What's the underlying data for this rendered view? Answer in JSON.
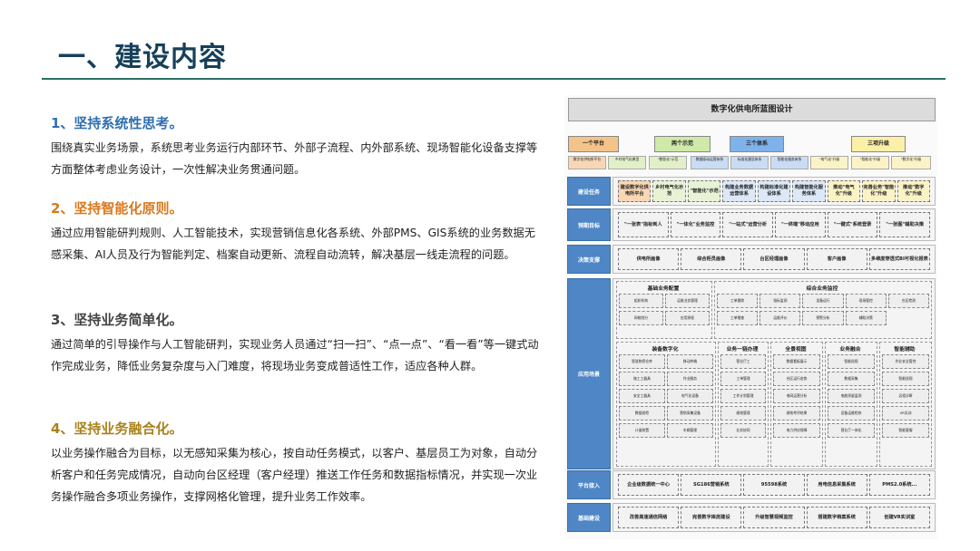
{
  "page": {
    "title": "一、建设内容"
  },
  "sections": [
    {
      "heading": "1、坚持系统性思考。",
      "body": "围绕真实业务场景，系统思考业务运行内部环节、外部子流程、内外部系统、现场智能化设备支撑等方面整体考虑业务设计，一次性解决业务贯通问题。"
    },
    {
      "heading": "2、坚持智能化原则。",
      "body": "通过应用智能研判规则、人工智能技术，实现营销信息化各系统、外部PMS、GIS系统的业务数据无感采集、AI人员及行为智能判定、档案自动更新、流程自动流转，解决基层一线走流程的问题。"
    },
    {
      "heading": "3、坚持业务简单化。",
      "body": "通过简单的引导操作与人工智能研判，实现业务人员通过“扫一扫”、“点一点”、“看一看”等一键式动作完成业务，降低业务复杂度与入门难度，将现场业务变成普适性工作，适应各种人群。"
    },
    {
      "heading": "4、坚持业务融合化。",
      "body": "以业务操作融合为目标，以无感知采集为核心，按自动任务模式，以客户、基层员工为对象，自动分析客户和任务完成情况，自动向台区经理（客户经理）推送工作任务和数据指标情况，并实现一次业务操作融合多项业务操作，支撑网格化管理，提升业务工作效率。"
    }
  ],
  "diagram": {
    "title": "数字化供电所蓝图设计",
    "top_pills": [
      "一个平台",
      "两个示范",
      "三个体系",
      "三项升级"
    ],
    "top_pill_colors": [
      "#f4c38a",
      "#cfe9a8",
      "#7fb2ea",
      "#fbf0a8"
    ],
    "mini_items": [
      "数字化供电所平台",
      "乡村电气化典型",
      "\"数智化\"示范",
      "数据驱动运营体系",
      "标准化建设体系",
      "智能化服务体系",
      "\"电气化\"升级",
      "\"智能化\"升级",
      "\"数字化\"升级"
    ],
    "rows": [
      {
        "label": "建设任务",
        "cells": [
          "建设数字化供电所平台",
          "乡村电气化示范",
          "\"智能化\"示范",
          "构建业务数据运营体系",
          "构建标准化建设体系",
          "构建智能化服务体系",
          "推动\"电气化\"升级",
          "完善业务\"智能化\"升级",
          "推动\"数字化\"升级"
        ]
      },
      {
        "label": "预期目标",
        "cells": [
          "\"一张表\"指标到人",
          "\"一体化\"业务监控",
          "\"一站式\"运营分析",
          "\"一终端\"移动应用",
          "\"一键式\"系统登录",
          "\"一张图\"辅助决策"
        ]
      },
      {
        "label": "决策支撑",
        "cells": [
          "供电所画像",
          "综合柜员画像",
          "台区经理画像",
          "客户画像",
          "多维度穿透式BI可视化报表"
        ]
      },
      {
        "label": "应用场景",
        "cells": []
      },
      {
        "label": "平台接入",
        "cells": [
          "企业级数据统一中心",
          "SG186营销系统",
          "95598系统",
          "用电信息采集系统",
          "PMS2.0系统..."
        ]
      },
      {
        "label": "基础建设",
        "cells": [
          "改善高速通信网络",
          "完善数字库房建设",
          "升级智慧视频监控",
          "搭建数字档案系统",
          "创建VR实训室"
        ]
      }
    ],
    "scene_groups": {
      "basic_config": {
        "title": "基础业务配置",
        "items": [
          "组织机构",
          "运维业务管理",
          "网格划分",
          "应用授权"
        ]
      },
      "overall_monitor": {
        "title": "综合业务监控",
        "items": [
          "工单跟踪",
          "指标监测",
          "设备运行",
          "现场管控",
          "台区检测",
          "工单稽查",
          "运维评价",
          "预警分析",
          "辅助决策"
        ]
      },
      "equipment": {
        "title": "装备数字化",
        "items": [
          "智慧物资仓库",
          "移动终端",
          "施工工器具",
          "作业服务",
          "安全工器具",
          "电气化设备",
          "数据巡检",
          "营销采集设备",
          "计量装置",
          "车辆管理"
        ]
      },
      "one_stop": {
        "title": "业务一链办理",
        "items": [
          "营业厅工",
          "工单管理",
          "工作计划管理",
          "绩效管理",
          "业务协同"
        ]
      },
      "panorama": {
        "title": "全景视图",
        "items": [
          "数据看板展示",
          "台区运行态势",
          "电网运营分析",
          "绩效考评结果",
          "电力供应保障"
        ]
      },
      "fusion": {
        "title": "业务融合",
        "items": [
          "智能巡视",
          "数据采集",
          "电能质量监测",
          "设备运维检修",
          "营业厅一体化"
        ]
      },
      "assist": {
        "title": "智能辅助",
        "items": [
          "作业安全管控",
          "智能巡视",
          "远程诊断",
          "VR实训",
          "智能客服"
        ]
      }
    }
  }
}
